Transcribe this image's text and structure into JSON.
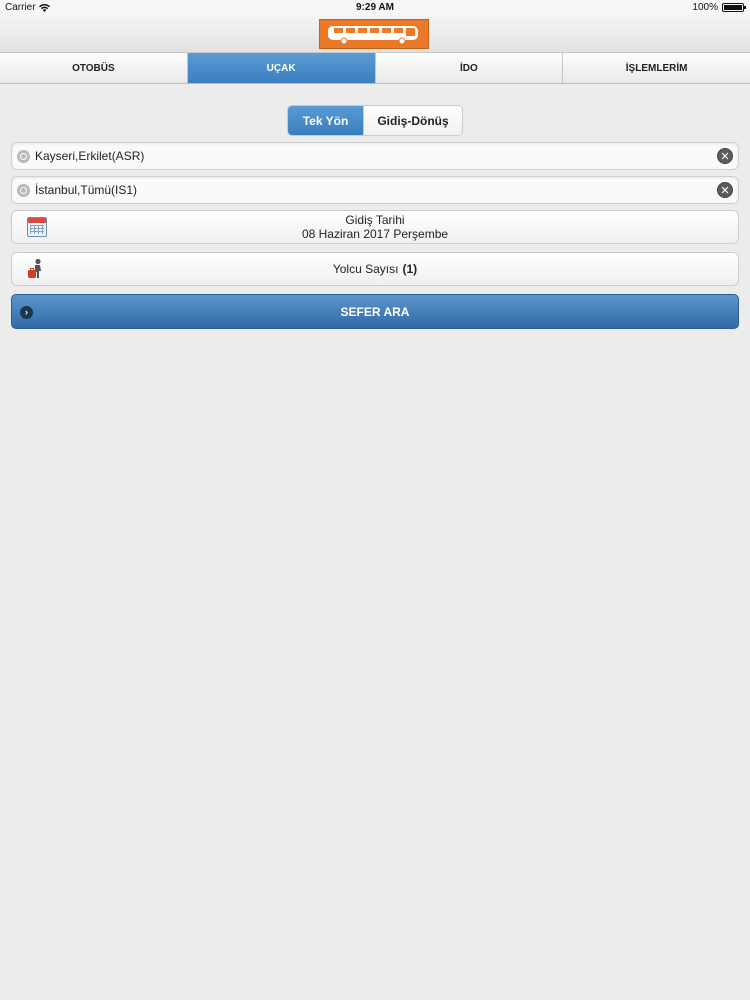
{
  "status_bar": {
    "carrier": "Carrier",
    "time": "9:29 AM",
    "battery": "100%",
    "battery_level": 1.0
  },
  "header": {
    "logo_icon": "bus-logo"
  },
  "tabs": [
    {
      "label": "OTOBÜS",
      "active": false
    },
    {
      "label": "UÇAK",
      "active": true
    },
    {
      "label": "İDO",
      "active": false
    },
    {
      "label": "İŞLEMLERİM",
      "active": false
    }
  ],
  "trip_type": {
    "one_way": "Tek Yön",
    "round_trip": "Gidiş-Dönüş",
    "selected": "Tek Yön"
  },
  "origin": {
    "value": "Kayseri,Erkilet(ASR)"
  },
  "destination": {
    "value": "İstanbul,Tümü(IS1)"
  },
  "departure": {
    "label": "Gidiş Tarihi",
    "date": "08 Haziran 2017 Perşembe"
  },
  "passengers": {
    "label": "Yolcu Sayısı",
    "count": "(1)"
  },
  "search_button": {
    "label": "SEFER ARA"
  },
  "colors": {
    "accent": "#3b7fc0",
    "logo": "#ea7a2a",
    "background": "#ececec"
  }
}
